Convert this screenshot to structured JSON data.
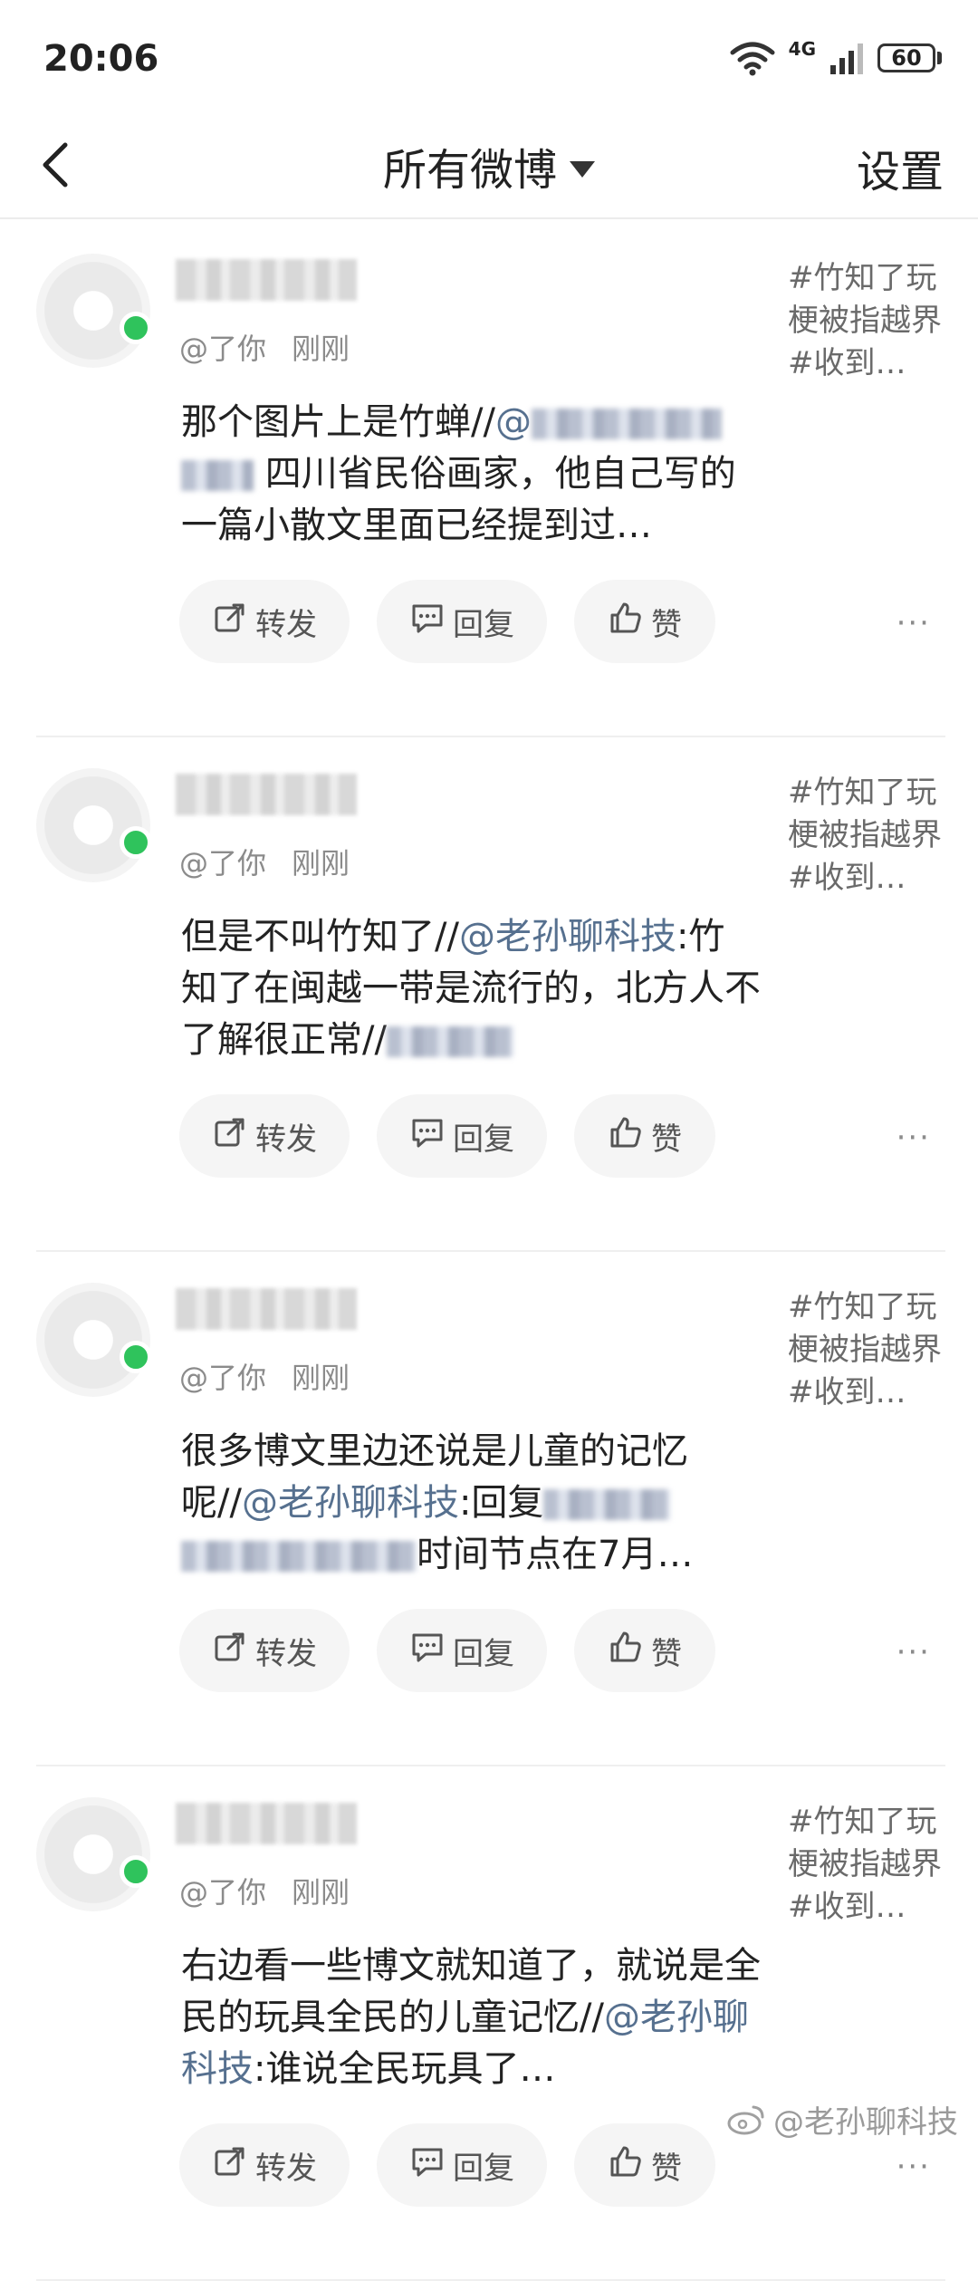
{
  "status_bar": {
    "time": "20:06",
    "network": "4G",
    "battery": "60"
  },
  "header": {
    "title": "所有微博",
    "settings_label": "设置"
  },
  "posts": [
    {
      "handle": "@了你",
      "time": "刚刚",
      "topic": "#竹知了玩梗被指越界#收到…",
      "parts": [
        "那个图片上是竹蝉//",
        "@",
        "四川省民俗画家，他自己写的一篇小散文里面已经提到过…"
      ]
    },
    {
      "handle": "@了你",
      "time": "刚刚",
      "topic": "#竹知了玩梗被指越界#收到…",
      "parts": [
        "但是不叫竹知了//",
        "@老孙聊科技",
        ":竹知了在闽越一带是流行的，北方人不了解很正常//"
      ]
    },
    {
      "handle": "@了你",
      "time": "刚刚",
      "topic": "#竹知了玩梗被指越界#收到…",
      "parts": [
        "很多博文里边还说是儿童的记忆呢//",
        "@老孙聊科技",
        ":回复",
        "时间节点在7月…"
      ]
    },
    {
      "handle": "@了你",
      "time": "刚刚",
      "topic": "#竹知了玩梗被指越界#收到…",
      "parts": [
        "右边看一些博文就知道了，就说是全民的玩具全民的儿童记忆//",
        "@老孙聊科技",
        ":谁说全民玩具了…"
      ]
    }
  ],
  "actions": {
    "repost": "转发",
    "reply": "回复",
    "like": "赞",
    "more": "···"
  },
  "watermark": "@老孙聊科技",
  "icons": [
    "back-icon",
    "dropdown-triangle-icon",
    "repost-icon",
    "reply-icon",
    "like-icon",
    "more-icon",
    "weibo-logo-icon",
    "wifi-icon",
    "signal-icon",
    "battery-icon"
  ],
  "colors": {
    "mention": "#56708f",
    "online": "#2fc35c"
  }
}
